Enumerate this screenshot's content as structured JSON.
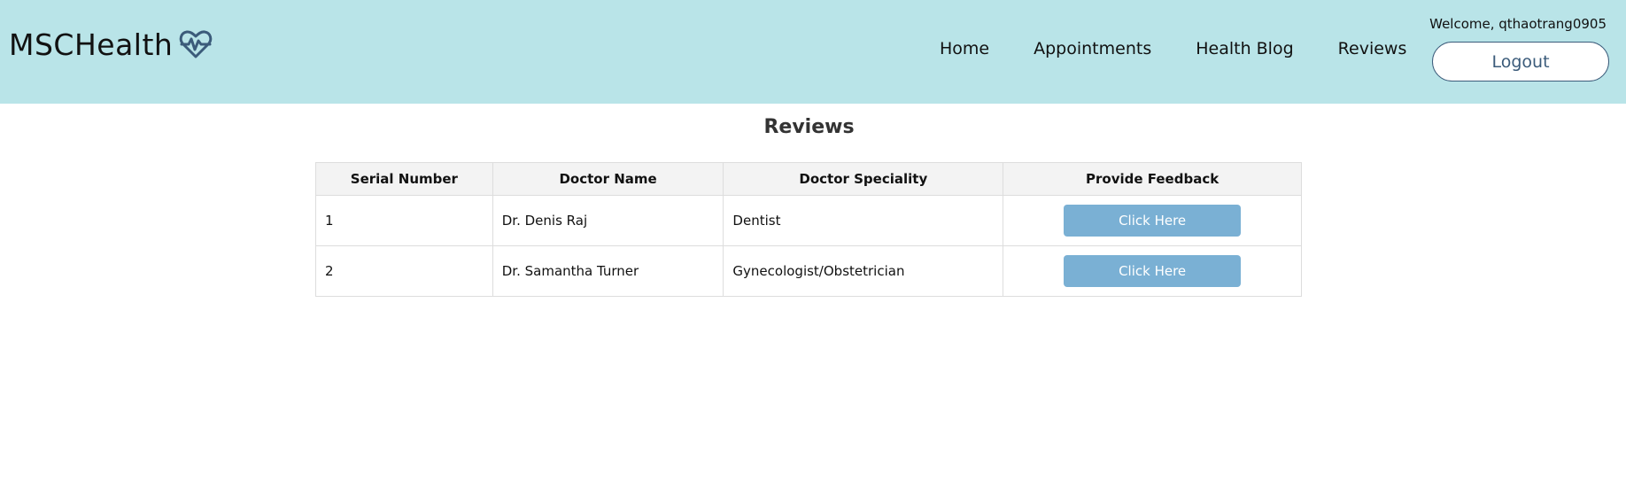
{
  "header": {
    "logo_text": "MSCHealth",
    "nav": [
      "Home",
      "Appointments",
      "Health Blog",
      "Reviews"
    ],
    "welcome": "Welcome, qthaotrang0905",
    "logout_label": "Logout"
  },
  "page": {
    "title": "Reviews"
  },
  "table": {
    "columns": [
      "Serial Number",
      "Doctor Name",
      "Doctor Speciality",
      "Provide Feedback"
    ],
    "rows": [
      {
        "serial": "1",
        "doctor": "Dr. Denis Raj",
        "speciality": "Dentist",
        "action": "Click Here"
      },
      {
        "serial": "2",
        "doctor": "Dr. Samantha Turner",
        "speciality": "Gynecologist/Obstetrician",
        "action": "Click Here"
      }
    ]
  },
  "colors": {
    "header_bg": "#b9e4e8",
    "button_bg": "#7ab0d4",
    "logout_border": "#3b5b7a"
  },
  "icons": {
    "logo": "heart-pulse-icon"
  }
}
